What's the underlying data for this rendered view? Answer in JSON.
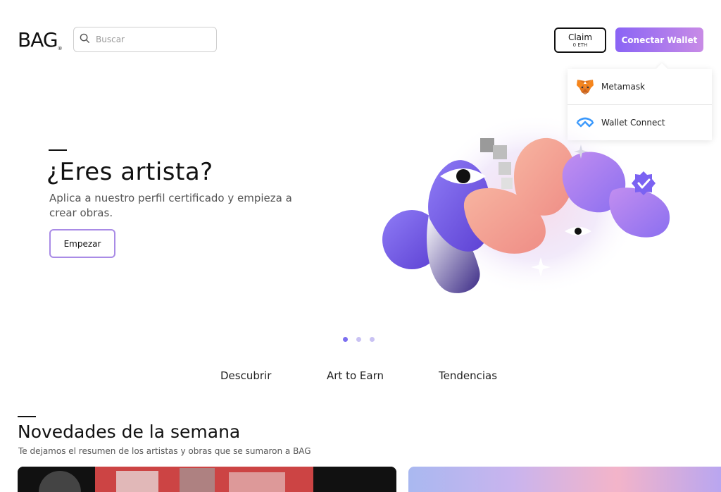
{
  "header": {
    "logo": "BAG",
    "logo_mark": "®",
    "search_placeholder": "Buscar",
    "search_value": "",
    "claim_label": "Claim",
    "claim_amount": "0 ETH",
    "connect_label": "Conectar Wallet"
  },
  "wallet_menu": {
    "items": [
      {
        "label": "Metamask",
        "icon": "metamask-fox-icon"
      },
      {
        "label": "Wallet Connect",
        "icon": "walletconnect-icon"
      }
    ]
  },
  "hero": {
    "title": "¿Eres artista?",
    "subtitle": "Aplica a nuestro perfil certificado y empieza a crear obras.",
    "cta": "Empezar"
  },
  "carousel": {
    "slides": 3,
    "active": 0
  },
  "nav": {
    "links": [
      "Descubrir",
      "Art to Earn",
      "Tendencias"
    ]
  },
  "section": {
    "title": "Novedades de la semana",
    "subtitle": "Te dejamos el resumen de los artistas y obras que se sumaron a BAG"
  },
  "colors": {
    "accent": "#8a64f5",
    "accent_light": "#c88be6",
    "peach": "#f3a08e",
    "dot_inactive": "#c9c2f3"
  }
}
